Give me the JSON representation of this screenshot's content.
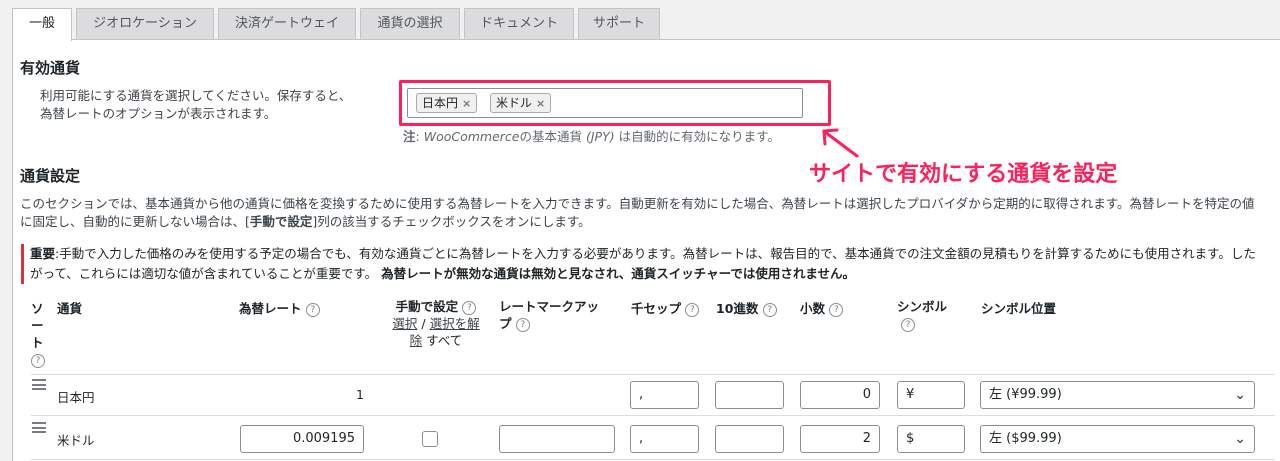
{
  "tabs": [
    {
      "label": "一般",
      "active": true
    },
    {
      "label": "ジオロケーション"
    },
    {
      "label": "決済ゲートウェイ"
    },
    {
      "label": "通貨の選択"
    },
    {
      "label": "ドキュメント"
    },
    {
      "label": "サポート"
    }
  ],
  "enabled_currencies": {
    "heading": "有効通貨",
    "description_line1": "利用可能にする通貨を選択してください。保存すると、",
    "description_line2": "為替レートのオプションが表示されます。",
    "selected": [
      "日本円",
      "米ドル"
    ],
    "remove_symbol": "×",
    "note_label": "注",
    "note_text_a": ": ",
    "note_italic": "WooCommerce",
    "note_text_b": "の基本通貨 ",
    "note_code": "(JPY)",
    "note_text_c": " は自動的に有効になります。"
  },
  "annotation": {
    "text": "サイトで有効にする通貨を設定",
    "color": "#ff1f5a"
  },
  "currency_settings": {
    "heading": "通貨設定",
    "desc_line1": "このセクションでは、基本通貨から他の通貨に価格を変換するために使用する為替レートを入力できます。自動更新を有効にした場合、為替レートは選択したプロバイダから定期的に取得されます。為替レートを特定の値",
    "desc_line2_a": "に固定し、自動的に更新しない場合は、[",
    "desc_line2_bold": "手動で設定",
    "desc_line2_b": "]列の該当するチェックボックスをオンにします。",
    "warn_label": "重要",
    "warn_line1": ":手動で入力した価格のみを使用する予定の場合でも、有効な通貨ごとに為替レートを入力する必要があります。為替レートは、報告目的で、基本通貨での注文金額の見積もりを計算するためにも使用されます。した",
    "warn_line2": "がって、これらには適切な値が含まれていることが重要です。",
    "warn_bold": "為替レートが無効な通貨は無効と見なされ、通貨スイッチャーでは使用されません。"
  },
  "table": {
    "headers": {
      "sort": "ソート",
      "currency": "通貨",
      "rate": "為替レート",
      "manual": "手動で設定",
      "select_link": "選択",
      "separator": "/",
      "deselect_link_a": "選択を解",
      "deselect_link_b": "除",
      "all": "すべて",
      "markup": "レートマークアップ",
      "thousand_sep": "千セップ",
      "decimal_sep": "10進数",
      "decimals": "小数",
      "symbol": "シンボル",
      "symbol_position": "シンボル位置"
    },
    "help_glyph": "?",
    "rows": [
      {
        "currency": "日本円",
        "rate": "1",
        "rate_editable": false,
        "manual": null,
        "markup": null,
        "thousand_sep": ",",
        "decimal_sep": "",
        "decimals": "0",
        "symbol": "¥",
        "position": "左 (¥99.99)"
      },
      {
        "currency": "米ドル",
        "rate": "0.009195",
        "rate_editable": true,
        "manual": false,
        "markup": "",
        "thousand_sep": ",",
        "decimal_sep": "",
        "decimals": "2",
        "symbol": "$",
        "position": "左 ($99.99)"
      }
    ]
  }
}
